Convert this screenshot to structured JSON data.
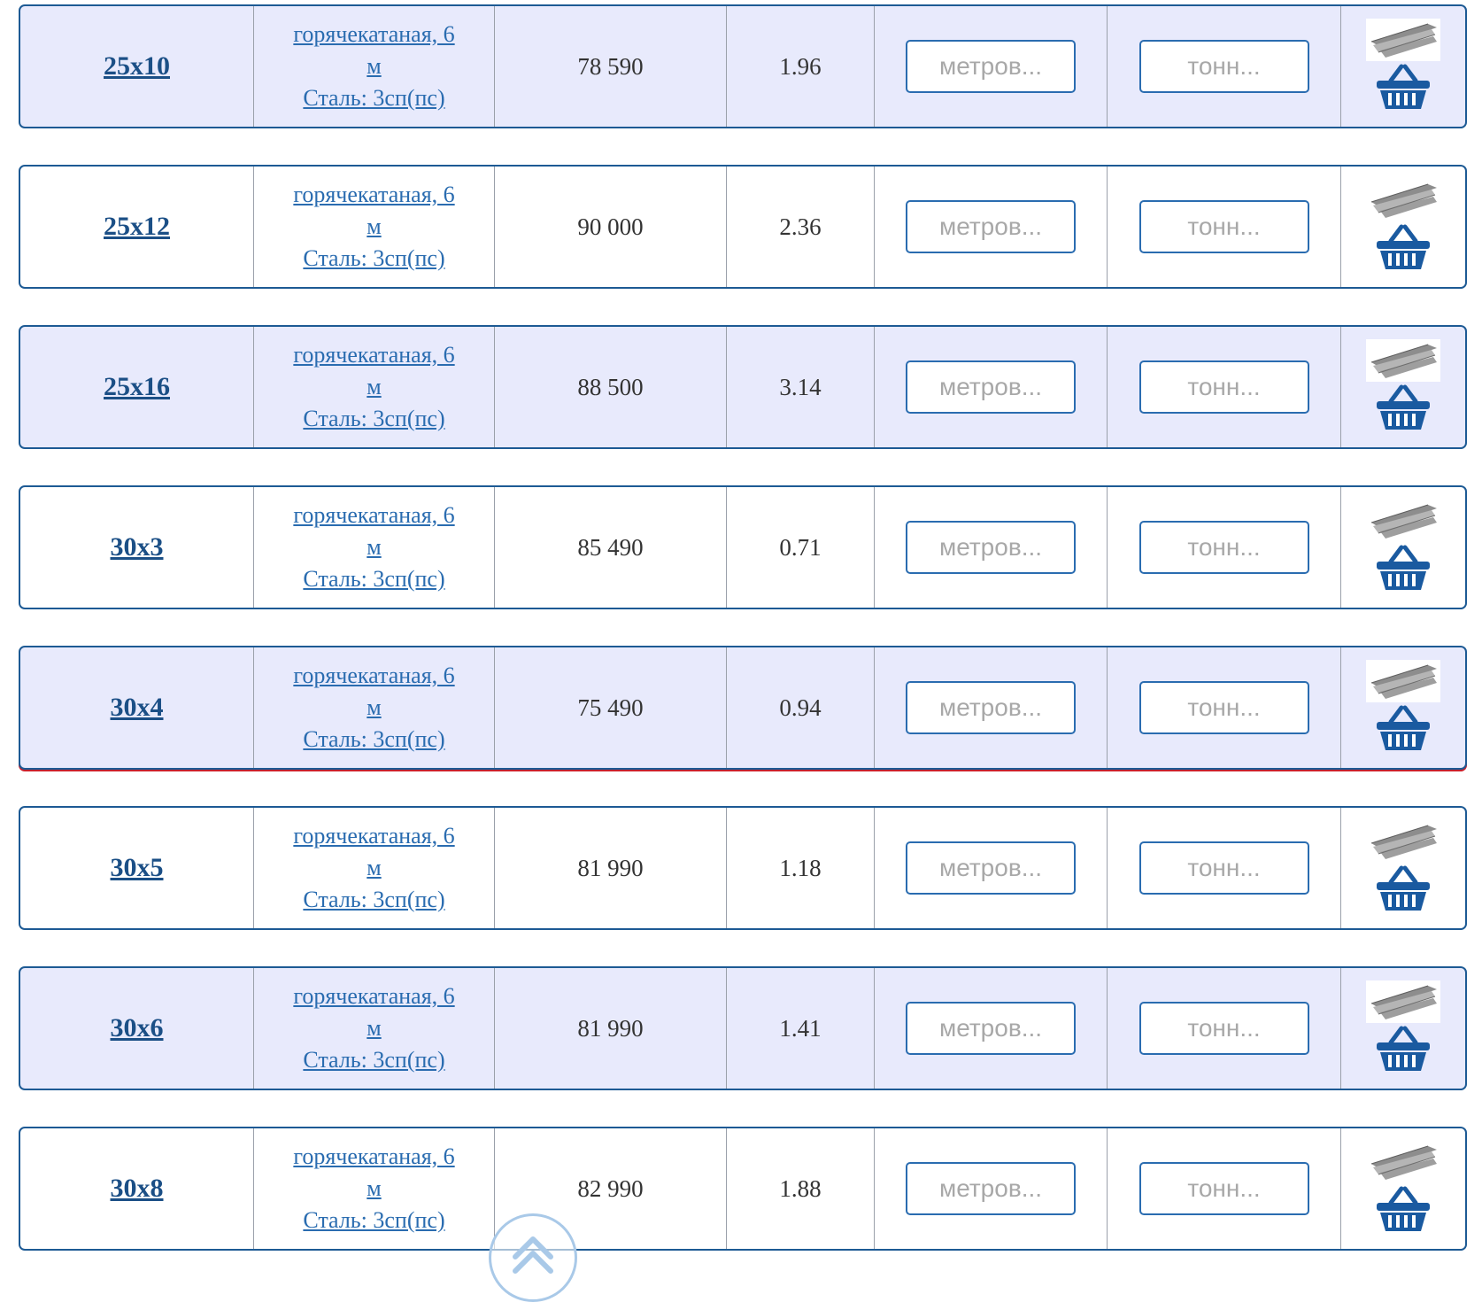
{
  "colors": {
    "accent": "#1d5a94",
    "row_alt_bg": "#e8eafc",
    "link": "#2a6cb0",
    "hover_line": "#c8202c"
  },
  "placeholders": {
    "meters": "метров...",
    "tons": "тонн..."
  },
  "icons": {
    "product_thumb": "steel-strip-image",
    "cart": "basket-icon",
    "scroll_top": "chevron-up-icon"
  },
  "rows": [
    {
      "size": "25x10",
      "desc_line1": "горячекатаная, 6",
      "desc_line2": "м",
      "desc_line3": "Сталь: 3сп(пс)",
      "price": "78 590",
      "weight": "1.96"
    },
    {
      "size": "25x12",
      "desc_line1": "горячекатаная, 6",
      "desc_line2": "м",
      "desc_line3": "Сталь: 3сп(пс)",
      "price": "90 000",
      "weight": "2.36"
    },
    {
      "size": "25x16",
      "desc_line1": "горячекатаная, 6",
      "desc_line2": "м",
      "desc_line3": "Сталь: 3сп(пс)",
      "price": "88 500",
      "weight": "3.14"
    },
    {
      "size": "30x3",
      "desc_line1": "горячекатаная, 6",
      "desc_line2": "м",
      "desc_line3": "Сталь: 3сп(пс)",
      "price": "85 490",
      "weight": "0.71"
    },
    {
      "size": "30x4",
      "desc_line1": "горячекатаная, 6",
      "desc_line2": "м",
      "desc_line3": "Сталь: 3сп(пс)",
      "price": "75 490",
      "weight": "0.94"
    },
    {
      "size": "30x5",
      "desc_line1": "горячекатаная, 6",
      "desc_line2": "м",
      "desc_line3": "Сталь: 3сп(пс)",
      "price": "81 990",
      "weight": "1.18"
    },
    {
      "size": "30x6",
      "desc_line1": "горячекатаная, 6",
      "desc_line2": "м",
      "desc_line3": "Сталь: 3сп(пс)",
      "price": "81 990",
      "weight": "1.41"
    },
    {
      "size": "30x8",
      "desc_line1": "горячекатаная, 6",
      "desc_line2": "м",
      "desc_line3": "Сталь: 3сп(пс)",
      "price": "82 990",
      "weight": "1.88"
    }
  ]
}
